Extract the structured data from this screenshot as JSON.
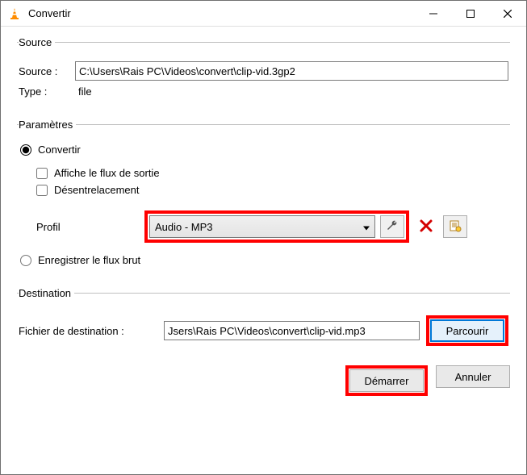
{
  "window": {
    "title": "Convertir"
  },
  "source": {
    "legend": "Source",
    "source_label": "Source :",
    "source_value": "C:\\Users\\Rais PC\\Videos\\convert\\clip-vid.3gp2",
    "type_label": "Type :",
    "type_value": "file"
  },
  "settings": {
    "legend": "Paramètres",
    "convert_label": "Convertir",
    "display_output_label": "Affiche le flux de sortie",
    "deinterlace_label": "Désentrelacement",
    "profile_label": "Profil",
    "profile_value": "Audio - MP3",
    "dump_raw_label": "Enregistrer le flux brut"
  },
  "destination": {
    "legend": "Destination",
    "file_label": "Fichier de destination :",
    "file_value": "Jsers\\Rais PC\\Videos\\convert\\clip-vid.mp3",
    "browse_label": "Parcourir"
  },
  "footer": {
    "start_label": "Démarrer",
    "cancel_label": "Annuler"
  },
  "icons": {
    "wrench": "wrench",
    "delete": "delete",
    "new_profile": "new-profile"
  }
}
